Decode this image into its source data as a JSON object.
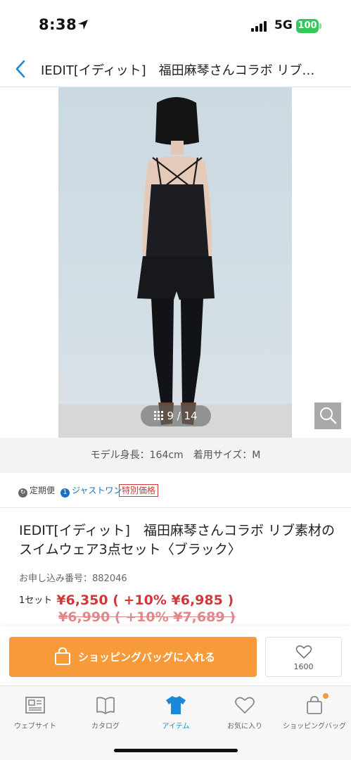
{
  "status_bar": {
    "time": "8:38",
    "network": "5G",
    "battery": "100",
    "battery_color": "#34c759"
  },
  "header": {
    "back_icon": "chevron-left-icon",
    "title": "IEDIT[イディット]　福田麻琴さんコラボ リブ…"
  },
  "gallery": {
    "counter": "9 / 14",
    "zoom_icon": "search-icon"
  },
  "model_info": "モデル身長：164cm　着用サイズ：M",
  "tags": {
    "teiki": "定期便",
    "just_one": "ジャストワン",
    "special_price": "特別価格"
  },
  "product": {
    "name": "IEDIT[イディット]　福田麻琴さんコラボ リブ素材のスイムウェア3点セット〈ブラック〉",
    "order_no": "お申し込み番号：882046",
    "set_label": "1セット",
    "price": "¥6,350 ( +10% ¥6,985 )",
    "old_price": "¥6,990 ( +10% ¥7,689 )",
    "price_color": "#d0383a"
  },
  "actions": {
    "cart_label": "ショッピングバッグに入れる",
    "cart_color": "#f79a3a",
    "favorite_count": "1600"
  },
  "tabbar": {
    "items": [
      {
        "label": "ウェブサイト",
        "icon": "newspaper-icon"
      },
      {
        "label": "カタログ",
        "icon": "book-icon"
      },
      {
        "label": "アイテム",
        "icon": "shirt-icon"
      },
      {
        "label": "お気に入り",
        "icon": "heart-icon"
      },
      {
        "label": "ショッピングバッグ",
        "icon": "bag-icon"
      }
    ],
    "active_color": "#1a8ad8"
  }
}
